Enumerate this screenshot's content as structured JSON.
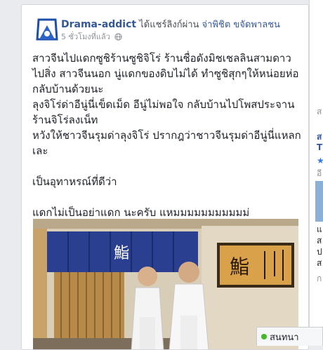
{
  "post": {
    "author": "Drama-addict",
    "action": " ได้แชร์ลิงก์ผ่าน ",
    "shared_with": "จ่าพิชิต ขจัดพาลชน",
    "time": "5 ชั่วโมงที่แล้ว",
    "privacy_icon": "globe-icon",
    "text": {
      "p1": "สาวจีนไปแดกซูชิร้านซูชิจิโร่ ร้านชื่อดังมิชเชลลินสามดาวไปสิ่ง สาวจีนนอก นู่แดกของดิบไม่ได้ ทำซูชิสุกๆให้หน่อยห่อกลับบ้านด้วยนะ",
      "p2": "ลุงจิโร่ด่าอีนู่นี่เข็ดเม็ด อีนู่ไม่พอใจ กลับบ้านไปโพสประจานร้านจิโร่ลงเน็ท",
      "p3": "หวังให้ชาวจีนรุมด่าลุงจิโร่ ปรากฎว่าชาวจีนรุมด่าอีนู่นี่แหลกเละ",
      "p4": "เป็นอุทาหรณ์ที่ดีว่า",
      "p5": "แดกไม่เป็นอย่าแดก นะครับ แหมมมมมมมมมมม่"
    },
    "photo": {
      "sign_left": "鮨",
      "sign_right": "鮨"
    }
  },
  "sidebar": {
    "cut_text_1": "ส",
    "cut_text_2": "ส",
    "cut_text_3": "T",
    "cut_text_4": "อี",
    "cut_text_5": "แ",
    "cut_text_6": "ส",
    "cut_text_7": "ป",
    "cut_text_8": "ส",
    "cut_text_9": "ก"
  },
  "chat": {
    "label": "สนทนา"
  },
  "colors": {
    "link": "#365899",
    "curtain": "#2a3f8f",
    "chat_online": "#42b72a"
  }
}
